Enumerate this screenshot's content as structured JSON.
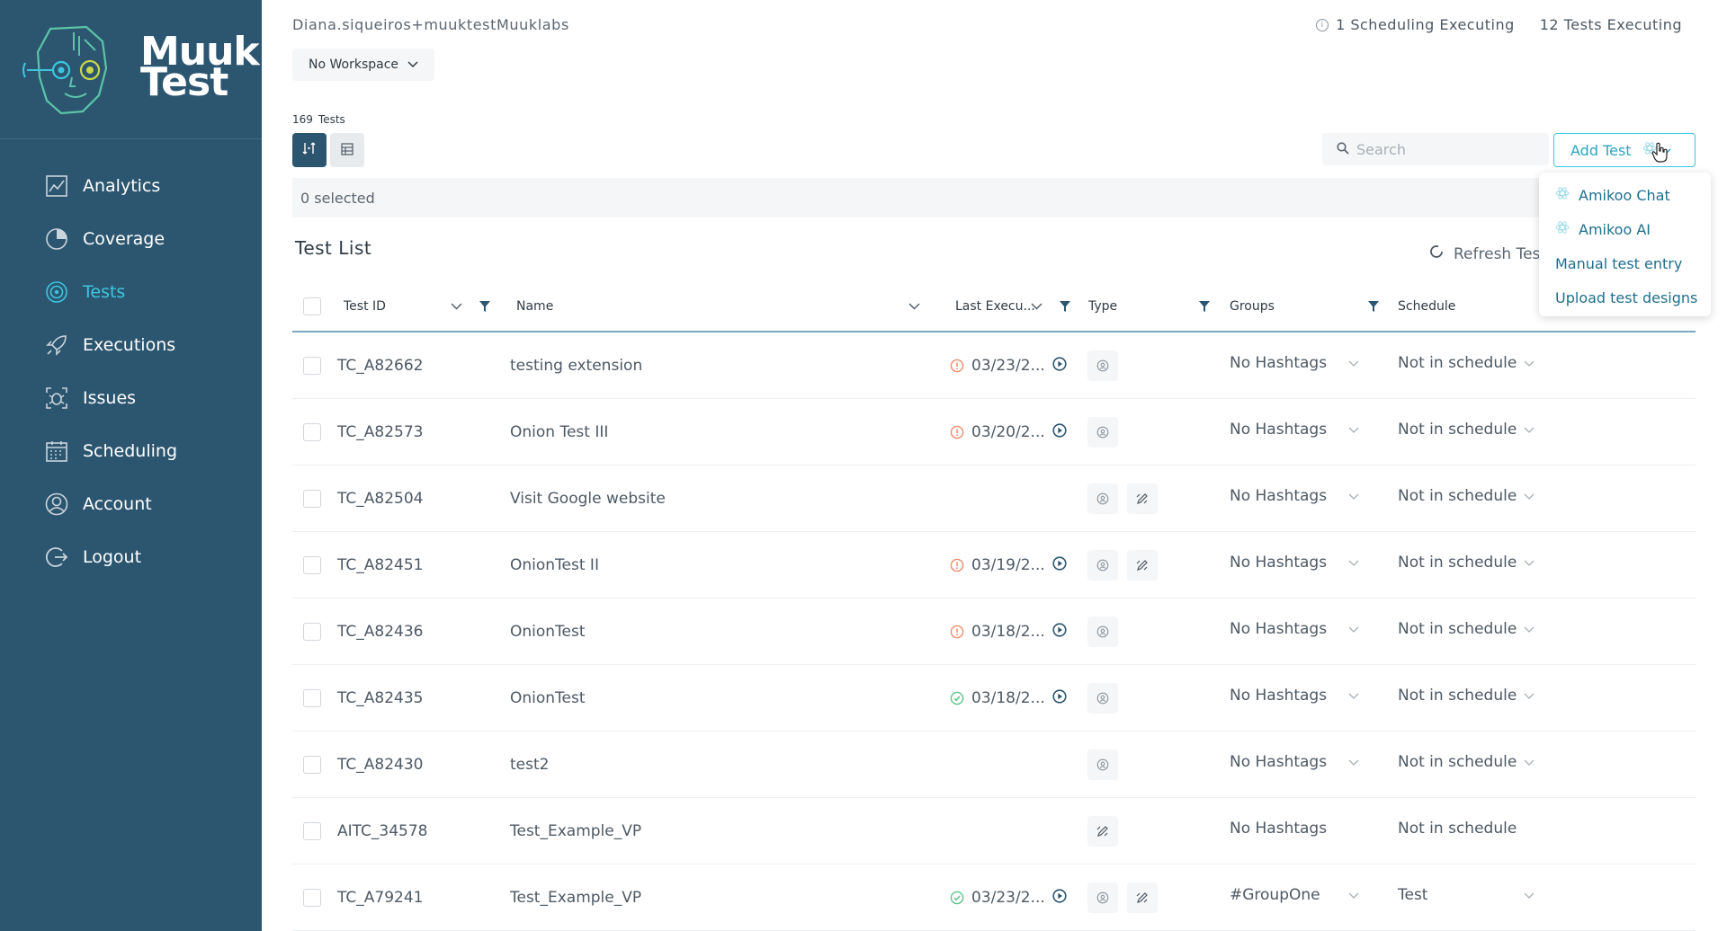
{
  "app": {
    "brand_line1": "Muuk",
    "brand_line2": "Test"
  },
  "sidebar": {
    "items": [
      {
        "label": "Analytics",
        "icon": "analytics-icon",
        "active": false
      },
      {
        "label": "Coverage",
        "icon": "coverage-icon",
        "active": false
      },
      {
        "label": "Tests",
        "icon": "tests-icon",
        "active": true
      },
      {
        "label": "Executions",
        "icon": "rocket-icon",
        "active": false
      },
      {
        "label": "Issues",
        "icon": "bug-icon",
        "active": false
      },
      {
        "label": "Scheduling",
        "icon": "calendar-icon",
        "active": false
      },
      {
        "label": "Account",
        "icon": "user-icon",
        "active": false
      },
      {
        "label": "Logout",
        "icon": "logout-icon",
        "active": false
      }
    ]
  },
  "header": {
    "user_email": "Diana.siqueiros+muuktestMuuklabs",
    "workspace": "No Workspace",
    "scheduling_executing": "1 Scheduling Executing",
    "tests_executing": "12 Tests Executing"
  },
  "toolbar": {
    "tests_count": "169",
    "tests_label": "Tests",
    "search_placeholder": "Search",
    "add_test_label": "Add Test",
    "selected_text": "0 selected"
  },
  "add_menu": {
    "items": [
      {
        "label": "Amikoo Chat",
        "icon": "atom-icon"
      },
      {
        "label": "Amikoo AI",
        "icon": "atom-icon"
      },
      {
        "label": "Manual test entry",
        "icon": ""
      },
      {
        "label": "Upload test designs",
        "icon": ""
      }
    ]
  },
  "list": {
    "title": "Test List",
    "refresh_label": "Refresh Tes",
    "columns": {
      "test_id": "Test ID",
      "name": "Name",
      "last_exec": "Last Execu...",
      "type": "Type",
      "groups": "Groups",
      "schedule": "Schedule"
    },
    "rows": [
      {
        "id": "TC_A82662",
        "name": "testing extension",
        "last": "03/23/2...",
        "status": "warning",
        "ai": true,
        "manual": false,
        "groups": "No Hashtags",
        "groups_dd": true,
        "schedule": "Not in schedule",
        "schedule_dd": true
      },
      {
        "id": "TC_A82573",
        "name": "Onion Test III",
        "last": "03/20/2...",
        "status": "warning",
        "ai": true,
        "manual": false,
        "groups": "No Hashtags",
        "groups_dd": true,
        "schedule": "Not in schedule",
        "schedule_dd": true
      },
      {
        "id": "TC_A82504",
        "name": "Visit Google website",
        "last": "",
        "status": "",
        "ai": true,
        "manual": true,
        "groups": "No Hashtags",
        "groups_dd": true,
        "schedule": "Not in schedule",
        "schedule_dd": true
      },
      {
        "id": "TC_A82451",
        "name": "OnionTest II",
        "last": "03/19/2...",
        "status": "warning",
        "ai": true,
        "manual": true,
        "groups": "No Hashtags",
        "groups_dd": true,
        "schedule": "Not in schedule",
        "schedule_dd": true
      },
      {
        "id": "TC_A82436",
        "name": "OnionTest",
        "last": "03/18/2...",
        "status": "warning",
        "ai": true,
        "manual": false,
        "groups": "No Hashtags",
        "groups_dd": true,
        "schedule": "Not in schedule",
        "schedule_dd": true
      },
      {
        "id": "TC_A82435",
        "name": "OnionTest",
        "last": "03/18/2...",
        "status": "success",
        "ai": true,
        "manual": false,
        "groups": "No Hashtags",
        "groups_dd": true,
        "schedule": "Not in schedule",
        "schedule_dd": true
      },
      {
        "id": "TC_A82430",
        "name": "test2",
        "last": "",
        "status": "",
        "ai": true,
        "manual": false,
        "groups": "No Hashtags",
        "groups_dd": true,
        "schedule": "Not in schedule",
        "schedule_dd": true
      },
      {
        "id": "AITC_34578",
        "name": "Test_Example_VP",
        "last": "",
        "status": "",
        "ai": false,
        "manual": true,
        "groups": "No Hashtags",
        "groups_dd": false,
        "schedule": "Not in schedule",
        "schedule_dd": false
      },
      {
        "id": "TC_A79241",
        "name": "Test_Example_VP",
        "last": "03/23/2...",
        "status": "success",
        "ai": true,
        "manual": true,
        "groups": "#GroupOne",
        "groups_dd": true,
        "schedule": "Test",
        "schedule_dd": true
      }
    ]
  },
  "colors": {
    "sidebar_bg": "#2c5670",
    "accent": "#3ec6e0",
    "warning": "#f08a6a",
    "success": "#5cc48a"
  }
}
